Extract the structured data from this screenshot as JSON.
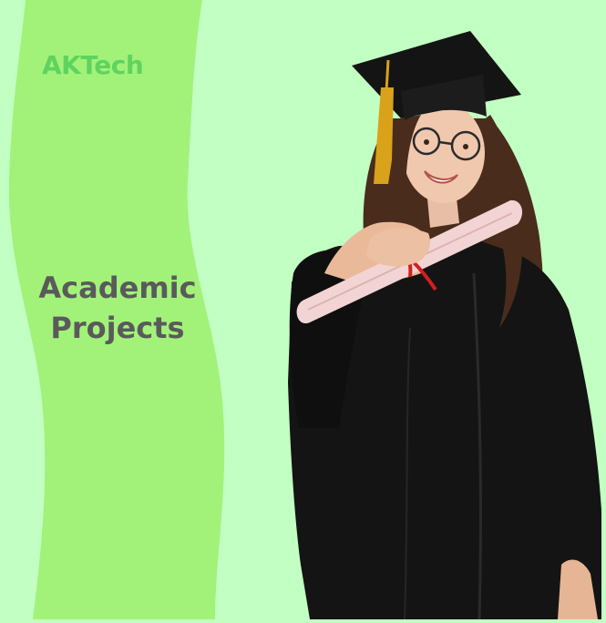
{
  "brand": {
    "name": "AKTech",
    "color": "#5fd35f"
  },
  "headline": {
    "line1": "Academic",
    "line2": "Projects"
  },
  "colors": {
    "background": "#c2ffc2",
    "ribbon": "#a2f27a",
    "text": "#5a5a5a"
  },
  "illustration": "graduate-in-cap-and-gown-holding-diploma"
}
